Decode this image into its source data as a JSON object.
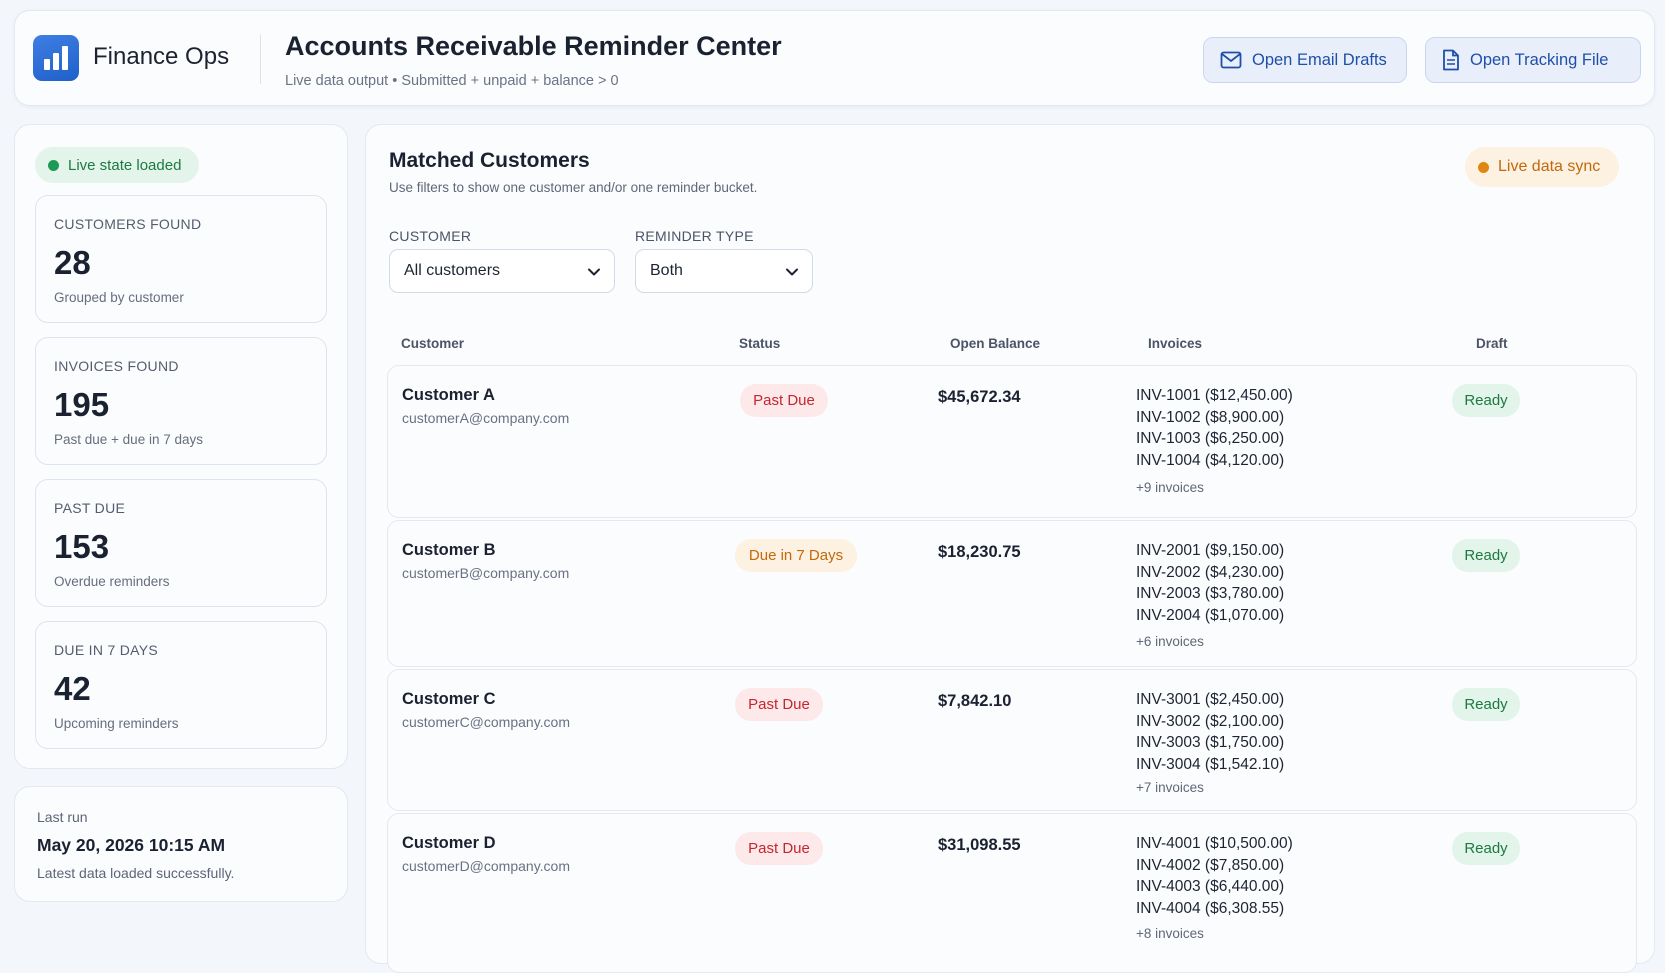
{
  "brand": {
    "name": "Finance Ops",
    "logo_icon": "bar-chart-logo-icon"
  },
  "header": {
    "title": "Accounts Receivable Reminder Center",
    "subtitle": "Live data output • Submitted + unpaid + balance > 0",
    "buttons": [
      {
        "label": "Open Email Drafts",
        "icon": "mail-icon"
      },
      {
        "label": "Open Tracking File",
        "icon": "document-icon"
      }
    ]
  },
  "sidebar": {
    "status_pill": "Live state loaded",
    "stats": [
      {
        "label": "CUSTOMERS FOUND",
        "value": "28",
        "sub": "Grouped by customer"
      },
      {
        "label": "INVOICES FOUND",
        "value": "195",
        "sub": "Past due + due in 7 days"
      },
      {
        "label": "PAST DUE",
        "value": "153",
        "sub": "Overdue reminders"
      },
      {
        "label": "DUE IN 7 DAYS",
        "value": "42",
        "sub": "Upcoming reminders"
      }
    ],
    "last_run": {
      "label": "Last run",
      "value": "May 20, 2026 10:15 AM",
      "sub": "Latest data loaded successfully."
    }
  },
  "main": {
    "title": "Matched Customers",
    "subtitle": "Use filters to show one customer and/or one reminder bucket.",
    "sync_pill": "Live data sync",
    "filters": {
      "customer": {
        "label": "CUSTOMER",
        "value": "All customers"
      },
      "reminder_type": {
        "label": "REMINDER TYPE",
        "value": "Both"
      }
    },
    "columns": [
      "Customer",
      "Status",
      "Open Balance",
      "Invoices",
      "Draft"
    ],
    "rows": [
      {
        "name": "Customer A",
        "email": "customerA@company.com",
        "status": "Past Due",
        "balance": "$45,672.34",
        "invoices": [
          "INV-1001 ($12,450.00)",
          "INV-1002 ($8,900.00)",
          "INV-1003 ($6,250.00)",
          "INV-1004 ($4,120.00)"
        ],
        "more": "+9 invoices",
        "draft": "Ready"
      },
      {
        "name": "Customer B",
        "email": "customerB@company.com",
        "status": "Due in 7 Days",
        "balance": "$18,230.75",
        "invoices": [
          "INV-2001 ($9,150.00)",
          "INV-2002 ($4,230.00)",
          "INV-2003 ($3,780.00)",
          "INV-2004 ($1,070.00)"
        ],
        "more": "+6 invoices",
        "draft": "Ready"
      },
      {
        "name": "Customer C",
        "email": "customerC@company.com",
        "status": "Past Due",
        "balance": "$7,842.10",
        "invoices": [
          "INV-3001 ($2,450.00)",
          "INV-3002 ($2,100.00)",
          "INV-3003 ($1,750.00)",
          "INV-3004 ($1,542.10)"
        ],
        "more": "+7 invoices",
        "draft": "Ready"
      },
      {
        "name": "Customer D",
        "email": "customerD@company.com",
        "status": "Past Due",
        "balance": "$31,098.55",
        "invoices": [
          "INV-4001 ($10,500.00)",
          "INV-4002 ($7,850.00)",
          "INV-4003 ($6,440.00)",
          "INV-4004 ($6,308.55)"
        ],
        "more": "+8 invoices",
        "draft": "Ready"
      }
    ]
  },
  "colors": {
    "accent": "#1f5fc9",
    "past_due": "#c4262f",
    "due_soon": "#c2690c",
    "ready": "#1c7a42"
  }
}
